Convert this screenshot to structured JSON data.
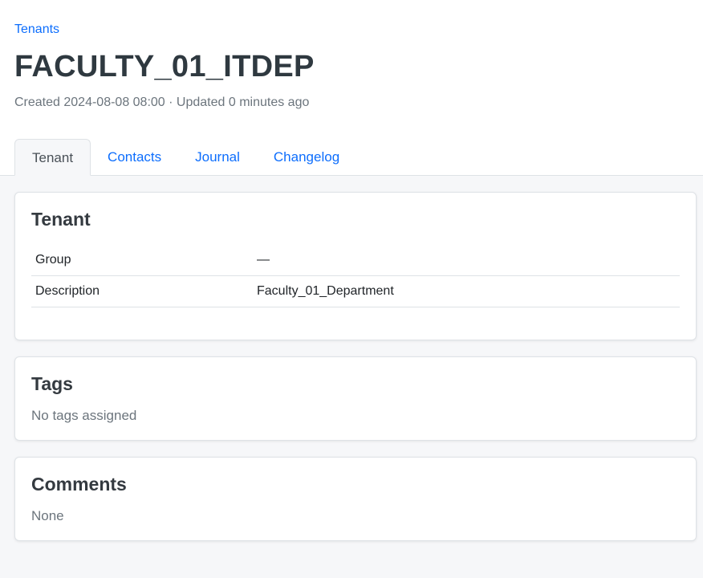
{
  "breadcrumb": {
    "label": "Tenants"
  },
  "title": "FACULTY_01_ITDEP",
  "meta": "Created 2024-08-08 08:00 · Updated 0 minutes ago",
  "tabs": [
    {
      "label": "Tenant",
      "active": true
    },
    {
      "label": "Contacts"
    },
    {
      "label": "Journal"
    },
    {
      "label": "Changelog"
    }
  ],
  "tenant_card": {
    "title": "Tenant",
    "rows": [
      {
        "key": "Group",
        "value": "—"
      },
      {
        "key": "Description",
        "value": "Faculty_01_Department"
      }
    ]
  },
  "tags_card": {
    "title": "Tags",
    "empty": "No tags assigned"
  },
  "comments_card": {
    "title": "Comments",
    "empty": "None"
  }
}
